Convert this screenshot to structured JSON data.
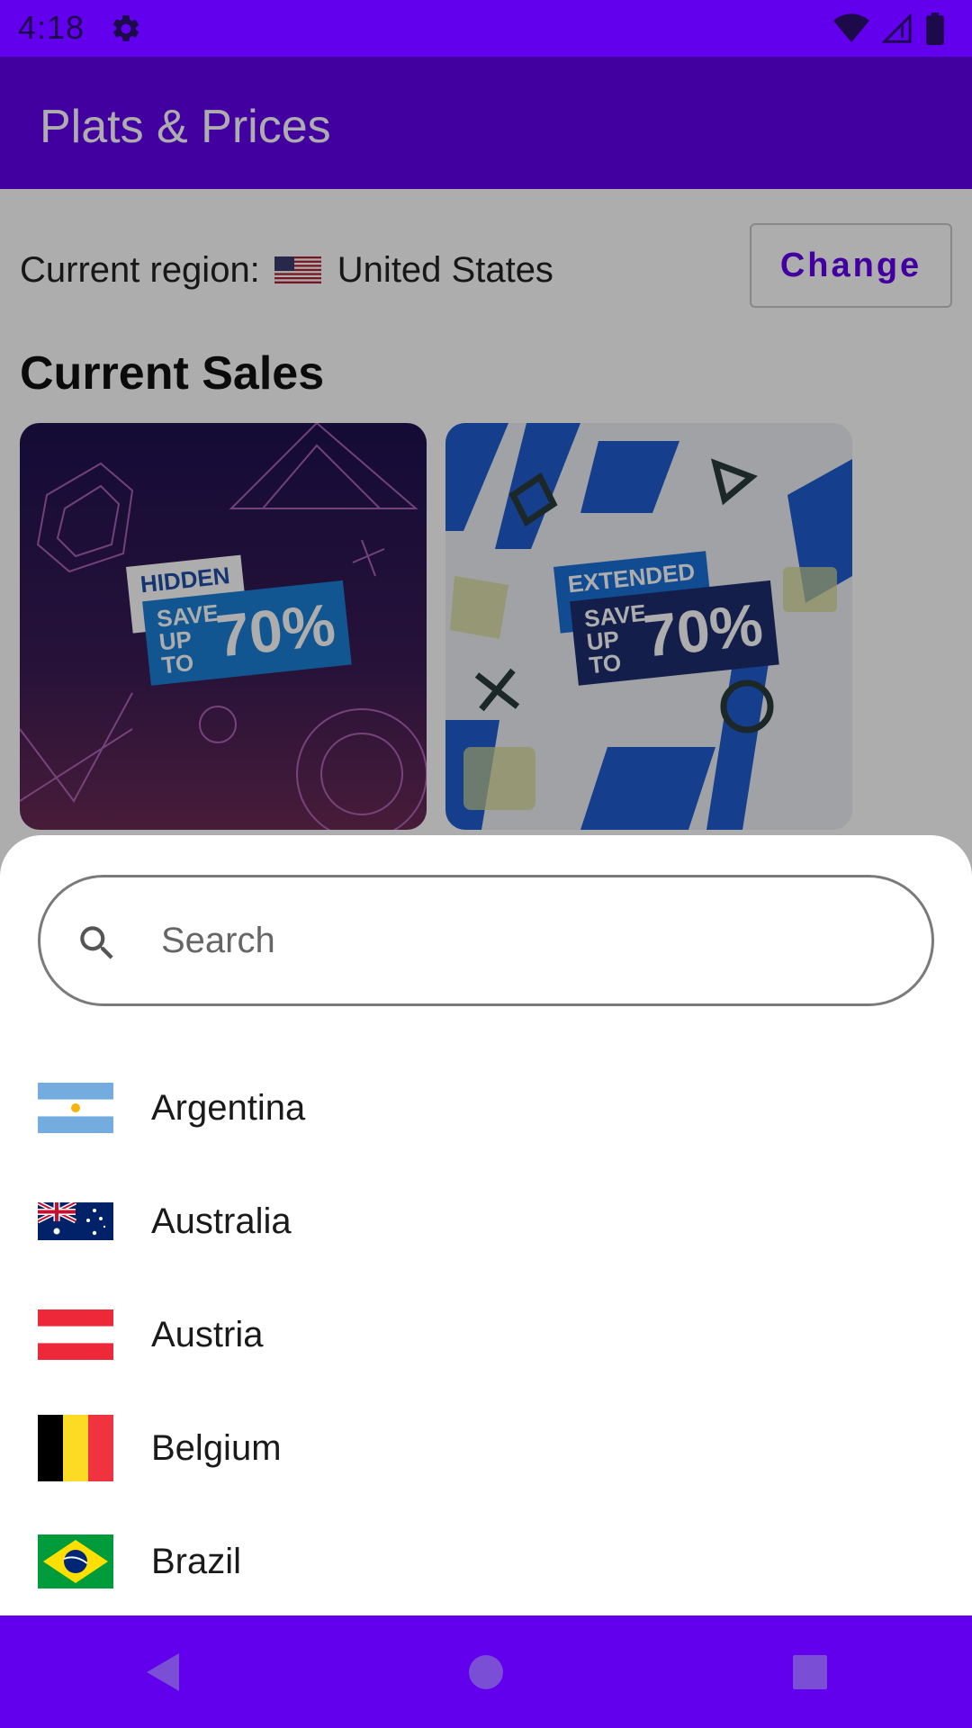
{
  "status_bar": {
    "time": "4:18",
    "icons": [
      "settings-icon",
      "wifi-icon",
      "signal-icon",
      "battery-icon"
    ]
  },
  "app_bar": {
    "title": "Plats & Prices"
  },
  "region": {
    "label": "Current region:",
    "country": "United States",
    "flag": "us-flag",
    "change_label": "Change"
  },
  "sales": {
    "title": "Current Sales",
    "cards": [
      {
        "badge_top": "HIDDEN GEMS",
        "badge_save": "SAVE UP TO",
        "badge_pct": "70%"
      },
      {
        "badge_top": "EXTENDED PLAY",
        "badge_save": "SAVE UP TO",
        "badge_pct": "70%"
      }
    ]
  },
  "sheet": {
    "search_placeholder": "Search",
    "countries": [
      {
        "name": "Argentina",
        "flag": "argentina-flag"
      },
      {
        "name": "Australia",
        "flag": "australia-flag"
      },
      {
        "name": "Austria",
        "flag": "austria-flag"
      },
      {
        "name": "Belgium",
        "flag": "belgium-flag"
      },
      {
        "name": "Brazil",
        "flag": "brazil-flag"
      }
    ]
  },
  "nav": {
    "back": "back-icon",
    "home": "home-icon",
    "recents": "recents-icon"
  },
  "colors": {
    "primary": "#6200EE",
    "scrim": "rgba(0,0,0,0.32)"
  }
}
